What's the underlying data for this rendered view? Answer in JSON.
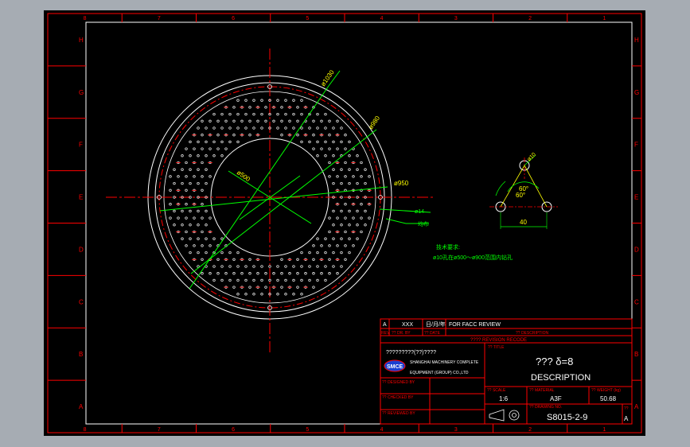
{
  "colors": {
    "background": "#000000",
    "frame": "#ff0000",
    "text": "#ffffff",
    "dims": "#ffff00",
    "leaders": "#00ff00",
    "circles": "#ffffff"
  },
  "border": {
    "columns_top": [
      "8",
      "7",
      "6",
      "5",
      "4",
      "3",
      "2",
      "1"
    ],
    "columns_bottom": [
      "8",
      "7",
      "6",
      "5",
      "4",
      "3",
      "2",
      "1"
    ],
    "rows_left": [
      "H",
      "G",
      "F",
      "E",
      "D",
      "C",
      "B",
      "A"
    ],
    "rows_right": [
      "H",
      "G",
      "F",
      "E",
      "D",
      "C",
      "B",
      "A"
    ]
  },
  "drawing": {
    "dim_d1030": "ø1030",
    "dim_d980": "ø980",
    "dim_d500": "ø500",
    "dim_d950": "ø950",
    "dim_phi14": "ø14",
    "note_chamfer": "均布",
    "detail_phi10": "ø10",
    "detail_60a": "60°",
    "detail_60b": "60°",
    "detail_40": "40",
    "tech_title": "技术要求:",
    "tech_note": "ø10孔在ø500～ø900范围内钻孔"
  },
  "revision_block": {
    "rev": "A",
    "by": "XXX",
    "date": "日/月/年",
    "description": "FOR FACC REVIEW",
    "hdr_rev": "REV.",
    "hdr_by": "?? DR. BY",
    "hdr_date": "?? DATE",
    "hdr_desc": "?? DESCRIPTION",
    "revision_recode": "???? REVISION RECODE"
  },
  "title_block": {
    "company_cn": "?????????(??)????",
    "company_en_line1": "SHANGHAI MACHINERY COMPLETE",
    "company_en_line2": "EQUIPMENT (GROUP) CO.,LTD",
    "logo_text": "SMCE",
    "title_label": "?? TITLE",
    "title_main": "??? δ=8",
    "title_sub": "DESCRIPTION",
    "designed_label": "?? DESIGNED BY",
    "checked_label": "?? CHECKED BY",
    "reviewed_label": "?? REVIEWED BY",
    "scale_label": "?? SCALE",
    "scale_value": "1:6",
    "material_label": "?? MATERIAL",
    "material_value": "A3F",
    "weight_label": "?? WEIGHT (kg)",
    "weight_value": "50.68",
    "drawing_no_label": "?? DRAWING NO.",
    "drawing_no_value": "S8015-2-9",
    "rev_label": "??",
    "rev_value": "A"
  }
}
